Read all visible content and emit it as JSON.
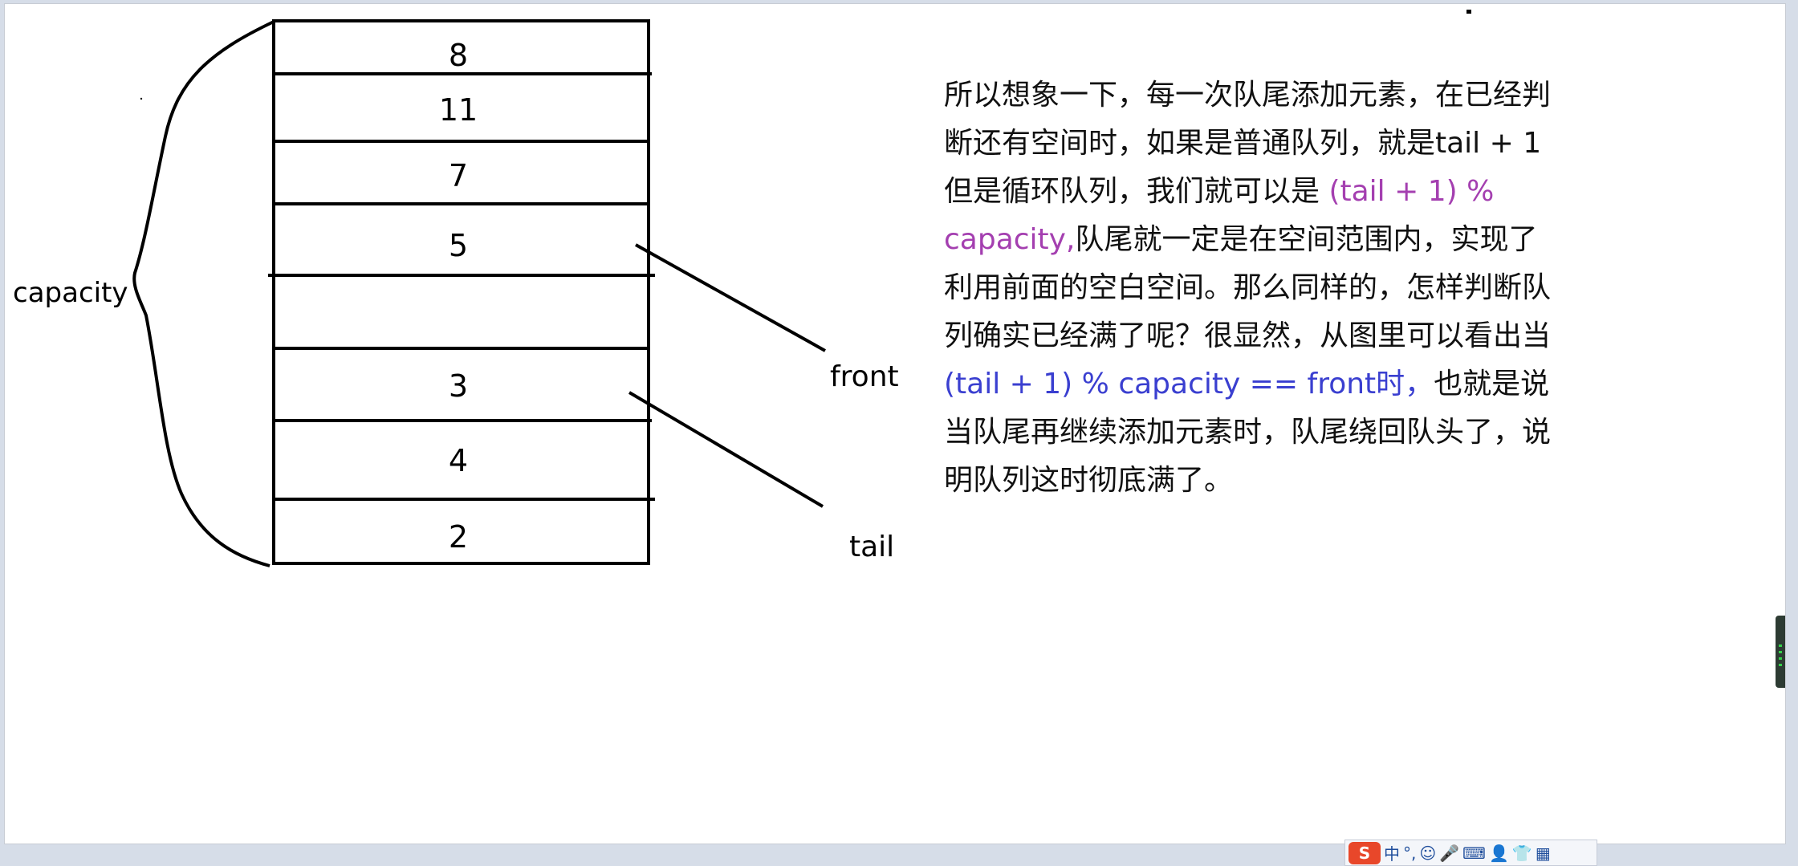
{
  "diagram": {
    "brace_label": "capacity",
    "cells": [
      "8",
      "11",
      "7",
      "5",
      "",
      "3",
      "4",
      "2"
    ],
    "front_label": "front",
    "tail_label": "tail"
  },
  "explanation": {
    "part1": "所以想象一下，每一次队尾添加元素，在已经判断还有空间时，如果是普通队列，就是tail + 1但是循环队列，我们就可以是 ",
    "formula1": "(tail + 1) % capacity,",
    "part2": "队尾就一定是在空间范围内，实现了利用前面的空白空间。那么同样的，怎样判断队列确实已经满了呢？很显然，从图里可以看出当 ",
    "formula2": "(tail + 1) % capacity == front时，",
    "part3": "也就是说当队尾再继续添加元素时，队尾绕回队头了，说明队列这时彻底满了。"
  },
  "colors": {
    "formula1": "#a43fb0",
    "formula2": "#3a3fd0"
  },
  "ime_toolbar": {
    "logo": "S",
    "mode": "中",
    "punct": "°,",
    "icons": [
      "smiley-icon",
      "microphone-icon",
      "keyboard-icon",
      "user-icon",
      "shirt-icon",
      "grid-icon"
    ]
  }
}
